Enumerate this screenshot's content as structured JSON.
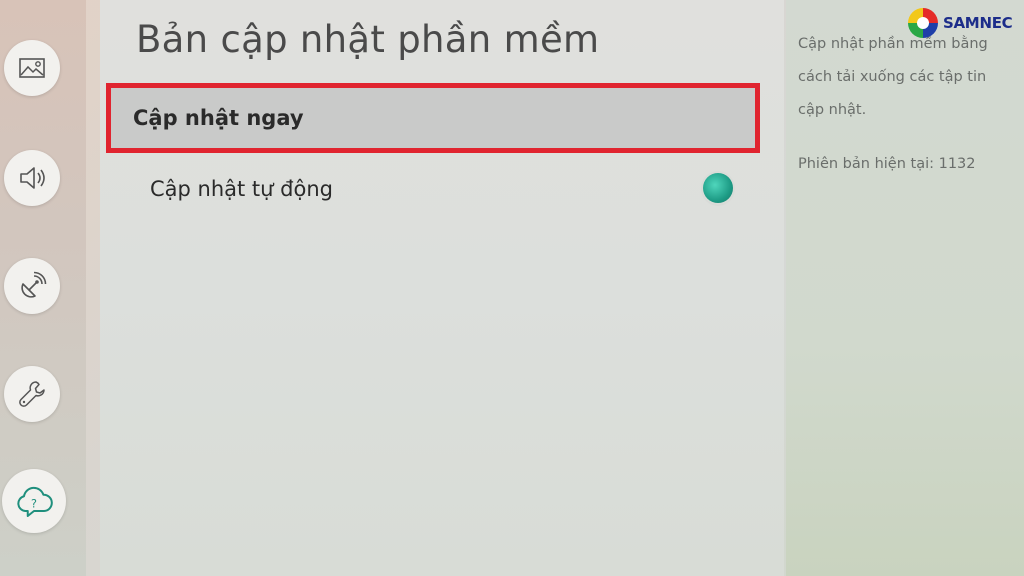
{
  "sidebar": {
    "items": [
      {
        "icon": "picture-icon"
      },
      {
        "icon": "sound-icon"
      },
      {
        "icon": "broadcast-icon"
      },
      {
        "icon": "wrench-icon"
      },
      {
        "icon": "support-cloud-icon",
        "active": true,
        "glyph": "?"
      }
    ]
  },
  "main": {
    "title": "Bản cập nhật phần mềm",
    "items": [
      {
        "label": "Cập nhật ngay",
        "focused": true
      },
      {
        "label": "Cập nhật tự động",
        "toggle_on": true
      }
    ]
  },
  "info": {
    "description": "Cập nhật phần mềm bằng cách tải xuống các tập tin cập nhật.",
    "version": "Phiên bản hiện tại: 1132"
  },
  "logo": {
    "text": "SAMNEC"
  },
  "colors": {
    "focus_border": "#e0242f",
    "toggle_on": "#1e9c86",
    "logo_text": "#1c2d8a"
  }
}
